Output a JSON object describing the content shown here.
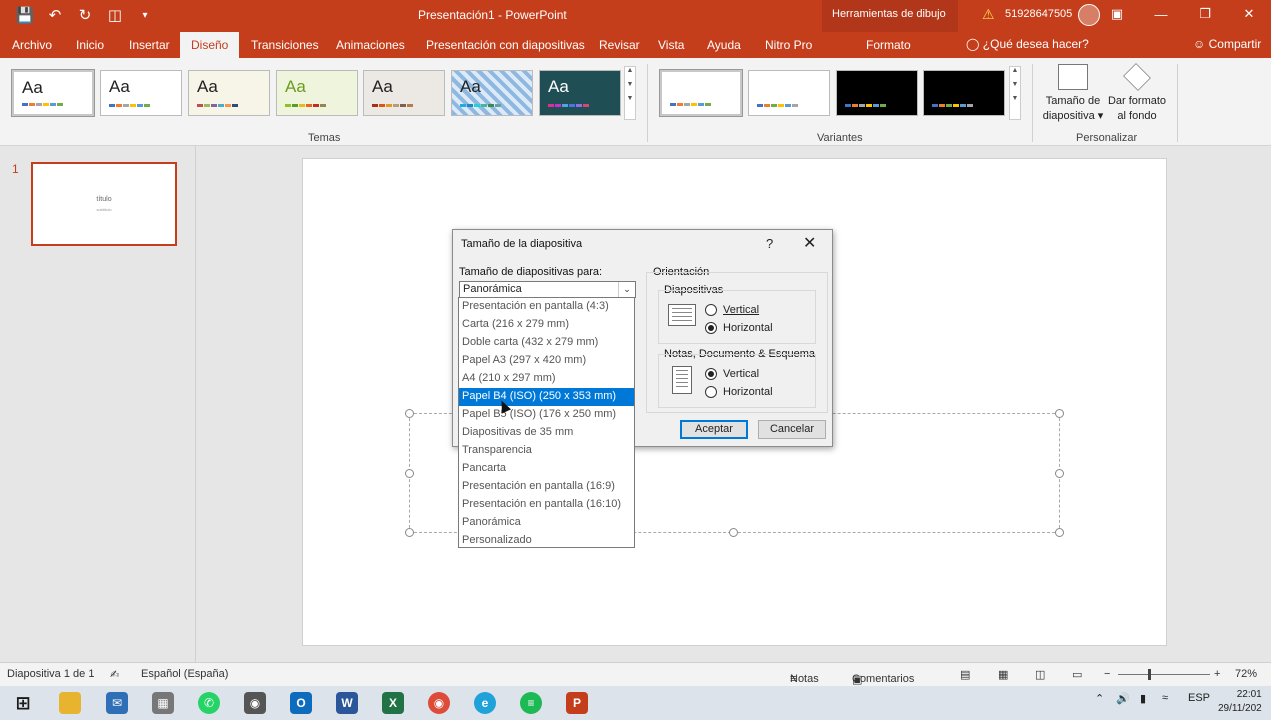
{
  "titlebar": {
    "doc_title": "Presentación1 - PowerPoint",
    "context_tool": "Herramientas de dibujo",
    "account": "51928647505",
    "min": "—",
    "restore": "❐",
    "close": "✕"
  },
  "tabs": [
    "Archivo",
    "Inicio",
    "Insertar",
    "Diseño",
    "Transiciones",
    "Animaciones",
    "Presentación con diapositivas",
    "Revisar",
    "Vista",
    "Ayuda",
    "Nitro Pro",
    "Formato"
  ],
  "help_search": "¿Qué desea hacer?",
  "share": "Compartir",
  "ribbon": {
    "themes_label": "Temas",
    "variants_label": "Variantes",
    "customize_label": "Personalizar",
    "slide_size_label_1": "Tamaño de",
    "slide_size_label_2": "diapositiva ▾",
    "format_bg_label_1": "Dar formato",
    "format_bg_label_2": "al fondo",
    "theme_glyph": "Aa"
  },
  "slide_pane": {
    "number": "1",
    "thumb_title": "título",
    "thumb_subtitle": "subtítulo"
  },
  "dialog": {
    "title": "Tamaño de la diapositiva",
    "help": "?",
    "close": "✕",
    "size_for_label": "Tamaño de diapositivas para:",
    "size_value": "Panorámica",
    "orientation_label": "Orientación",
    "slides_label": "Diapositivas",
    "slides_vertical": "Vertical",
    "slides_horizontal": "Horizontal",
    "slides_selected": "Horizontal",
    "notes_label": "Notas, Documento & Esquema",
    "notes_vertical": "Vertical",
    "notes_horizontal": "Horizontal",
    "notes_selected": "Vertical",
    "ok": "Aceptar",
    "cancel": "Cancelar"
  },
  "dropdown": {
    "items": [
      "Presentación en pantalla (4:3)",
      "Carta (216 x 279 mm)",
      "Doble carta (432 x 279 mm)",
      "Papel A3 (297 x 420 mm)",
      "A4 (210 x 297 mm)",
      "Papel B4 (ISO) (250 x 353 mm)",
      "Papel B5 (ISO) (176 x 250 mm)",
      "Diapositivas de 35 mm",
      "Transparencia",
      "Pancarta",
      "Presentación en pantalla (16:9)",
      "Presentación en pantalla (16:10)",
      "Panorámica",
      "Personalizado"
    ],
    "highlighted": "Papel B4 (ISO) (250 x 353 mm)"
  },
  "statusbar": {
    "slide_info": "Diapositiva 1 de 1",
    "language": "Español (España)",
    "notes": "Notas",
    "comments": "Comentarios",
    "zoom_minus": "−",
    "zoom_plus": "+",
    "zoom": "72%"
  },
  "taskbar": {
    "lang": "ESP",
    "time": "22:01",
    "date": "29/11/202"
  },
  "colors": {
    "accent": "#c43e1c",
    "selection": "#0078d7"
  }
}
